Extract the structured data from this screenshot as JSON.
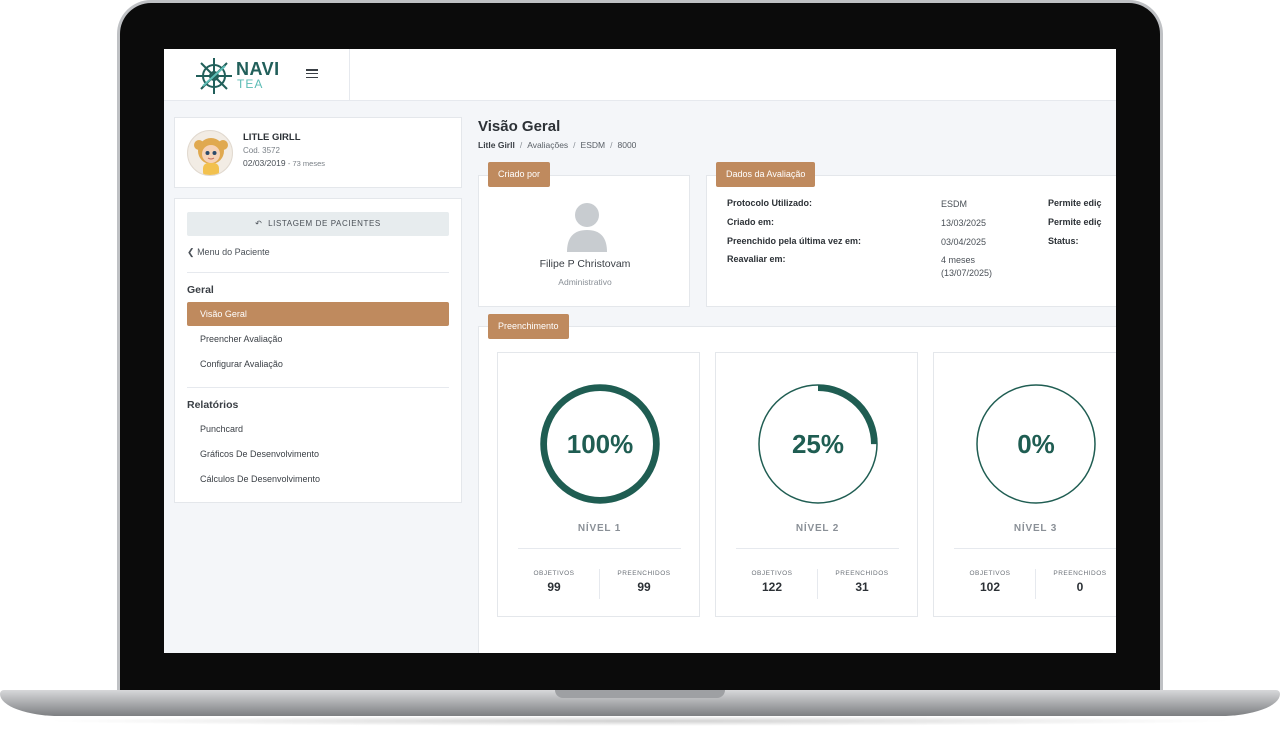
{
  "brand": {
    "name": "NAVI",
    "sub": "TEA"
  },
  "patient": {
    "name": "LITLE GIRLL",
    "code": "Cod. 3572",
    "birth_date": "02/03/2019",
    "age": "- 73 meses"
  },
  "sidebar": {
    "list_button": "LISTAGEM DE PACIENTES",
    "back_link": "Menu do Paciente",
    "sections": [
      {
        "title": "Geral",
        "items": [
          {
            "label": "Visão Geral"
          },
          {
            "label": "Preencher Avaliação"
          },
          {
            "label": "Configurar Avaliação"
          }
        ]
      },
      {
        "title": "Relatórios",
        "items": [
          {
            "label": "Punchcard"
          },
          {
            "label": "Gráficos De Desenvolvimento"
          },
          {
            "label": "Cálculos De Desenvolvimento"
          }
        ]
      }
    ]
  },
  "main": {
    "title": "Visão Geral",
    "breadcrumb": [
      "Litle Girll",
      "Avaliações",
      "ESDM",
      "8000"
    ],
    "creator": {
      "tag": "Criado por",
      "name": "Filipe P Christovam",
      "role": "Administrativo"
    },
    "evaluation": {
      "tag": "Dados da Avaliação",
      "rows": [
        {
          "label": "Protocolo Utilizado:",
          "value": "ESDM"
        },
        {
          "label": "Criado em:",
          "value": "13/03/2025"
        },
        {
          "label": "Preenchido pela última vez em:",
          "value": "03/04/2025"
        },
        {
          "label": "Reavaliar em:",
          "value": "4 meses",
          "value2": "(13/07/2025)"
        }
      ],
      "right_labels": [
        "Permite ediç",
        "Permite ediç",
        "Status:"
      ]
    },
    "fill": {
      "tag": "Preenchimento",
      "objectives_label": "OBJETIVOS",
      "filled_label": "PREENCHIDOS",
      "levels": [
        {
          "name": "NÍVEL 1",
          "percent": 100,
          "percent_text": "100%",
          "objectives": "99",
          "filled": "99"
        },
        {
          "name": "NÍVEL 2",
          "percent": 25,
          "percent_text": "25%",
          "objectives": "122",
          "filled": "31"
        },
        {
          "name": "NÍVEL 3",
          "percent": 0,
          "percent_text": "0%",
          "objectives": "102",
          "filled": "0"
        }
      ]
    }
  },
  "colors": {
    "accent": "#bf8a5e",
    "progress": "#1f5d52",
    "brand": "#215f5a"
  }
}
